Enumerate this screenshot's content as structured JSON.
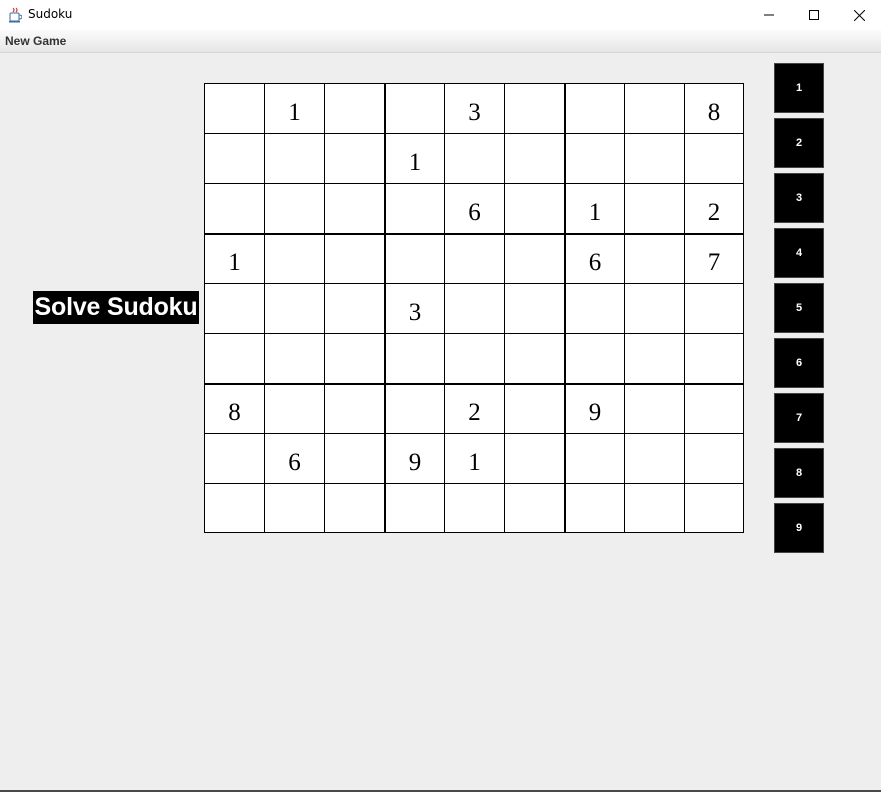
{
  "window": {
    "title": "Sudoku",
    "minimize_glyph": "—",
    "maximize_glyph": "☐",
    "close_glyph": "✕"
  },
  "menu": {
    "new_game": "New Game"
  },
  "solve_button": "Solve Sudoku",
  "board": [
    [
      "",
      "1",
      "",
      "",
      "3",
      "",
      "",
      "",
      "8"
    ],
    [
      "",
      "",
      "",
      "1",
      "",
      "",
      "",
      "",
      ""
    ],
    [
      "",
      "",
      "",
      "",
      "6",
      "",
      "1",
      "",
      "2"
    ],
    [
      "1",
      "",
      "",
      "",
      "",
      "",
      "6",
      "",
      "7"
    ],
    [
      "",
      "",
      "",
      "3",
      "",
      "",
      "",
      "",
      ""
    ],
    [
      "",
      "",
      "",
      "",
      "",
      "",
      "",
      "",
      ""
    ],
    [
      "8",
      "",
      "",
      "",
      "2",
      "",
      "9",
      "",
      ""
    ],
    [
      "",
      "6",
      "",
      "9",
      "1",
      "",
      "",
      "",
      ""
    ],
    [
      "",
      "",
      "",
      "",
      "",
      "",
      "",
      "",
      ""
    ]
  ],
  "number_buttons": [
    "1",
    "2",
    "3",
    "4",
    "5",
    "6",
    "7",
    "8",
    "9"
  ],
  "colors": {
    "background": "#eeeeee",
    "button_bg": "#000000",
    "button_text": "#ffffff"
  }
}
